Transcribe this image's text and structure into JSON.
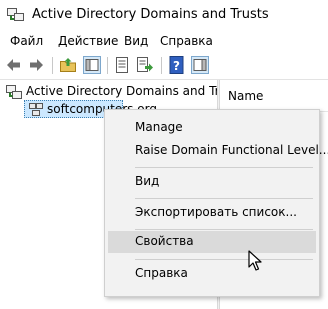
{
  "window": {
    "title": "Active Directory Domains and Trusts"
  },
  "menubar": {
    "items": [
      "Файл",
      "Действие",
      "Вид",
      "Справка"
    ]
  },
  "toolbar": {
    "buttons": [
      "back-arrow-icon",
      "forward-arrow-icon",
      "folder-up-icon",
      "show-hide-tree-icon",
      "properties-icon",
      "export-list-icon",
      "help-icon",
      "action-pane-icon"
    ]
  },
  "tree": {
    "root_label": "Active Directory Domains and Trusts",
    "child_label": "softcomputers.org"
  },
  "list": {
    "column_name": "Name"
  },
  "context_menu": {
    "items": [
      "Manage",
      "Raise Domain Functional Level...",
      "Вид",
      "Экспортировать список...",
      "Свойства",
      "Справка"
    ],
    "highlighted": "Свойства"
  },
  "colors": {
    "selection": "#cce8ff",
    "menu_bg": "#f2f2f2",
    "menu_highlight": "#dadada"
  }
}
